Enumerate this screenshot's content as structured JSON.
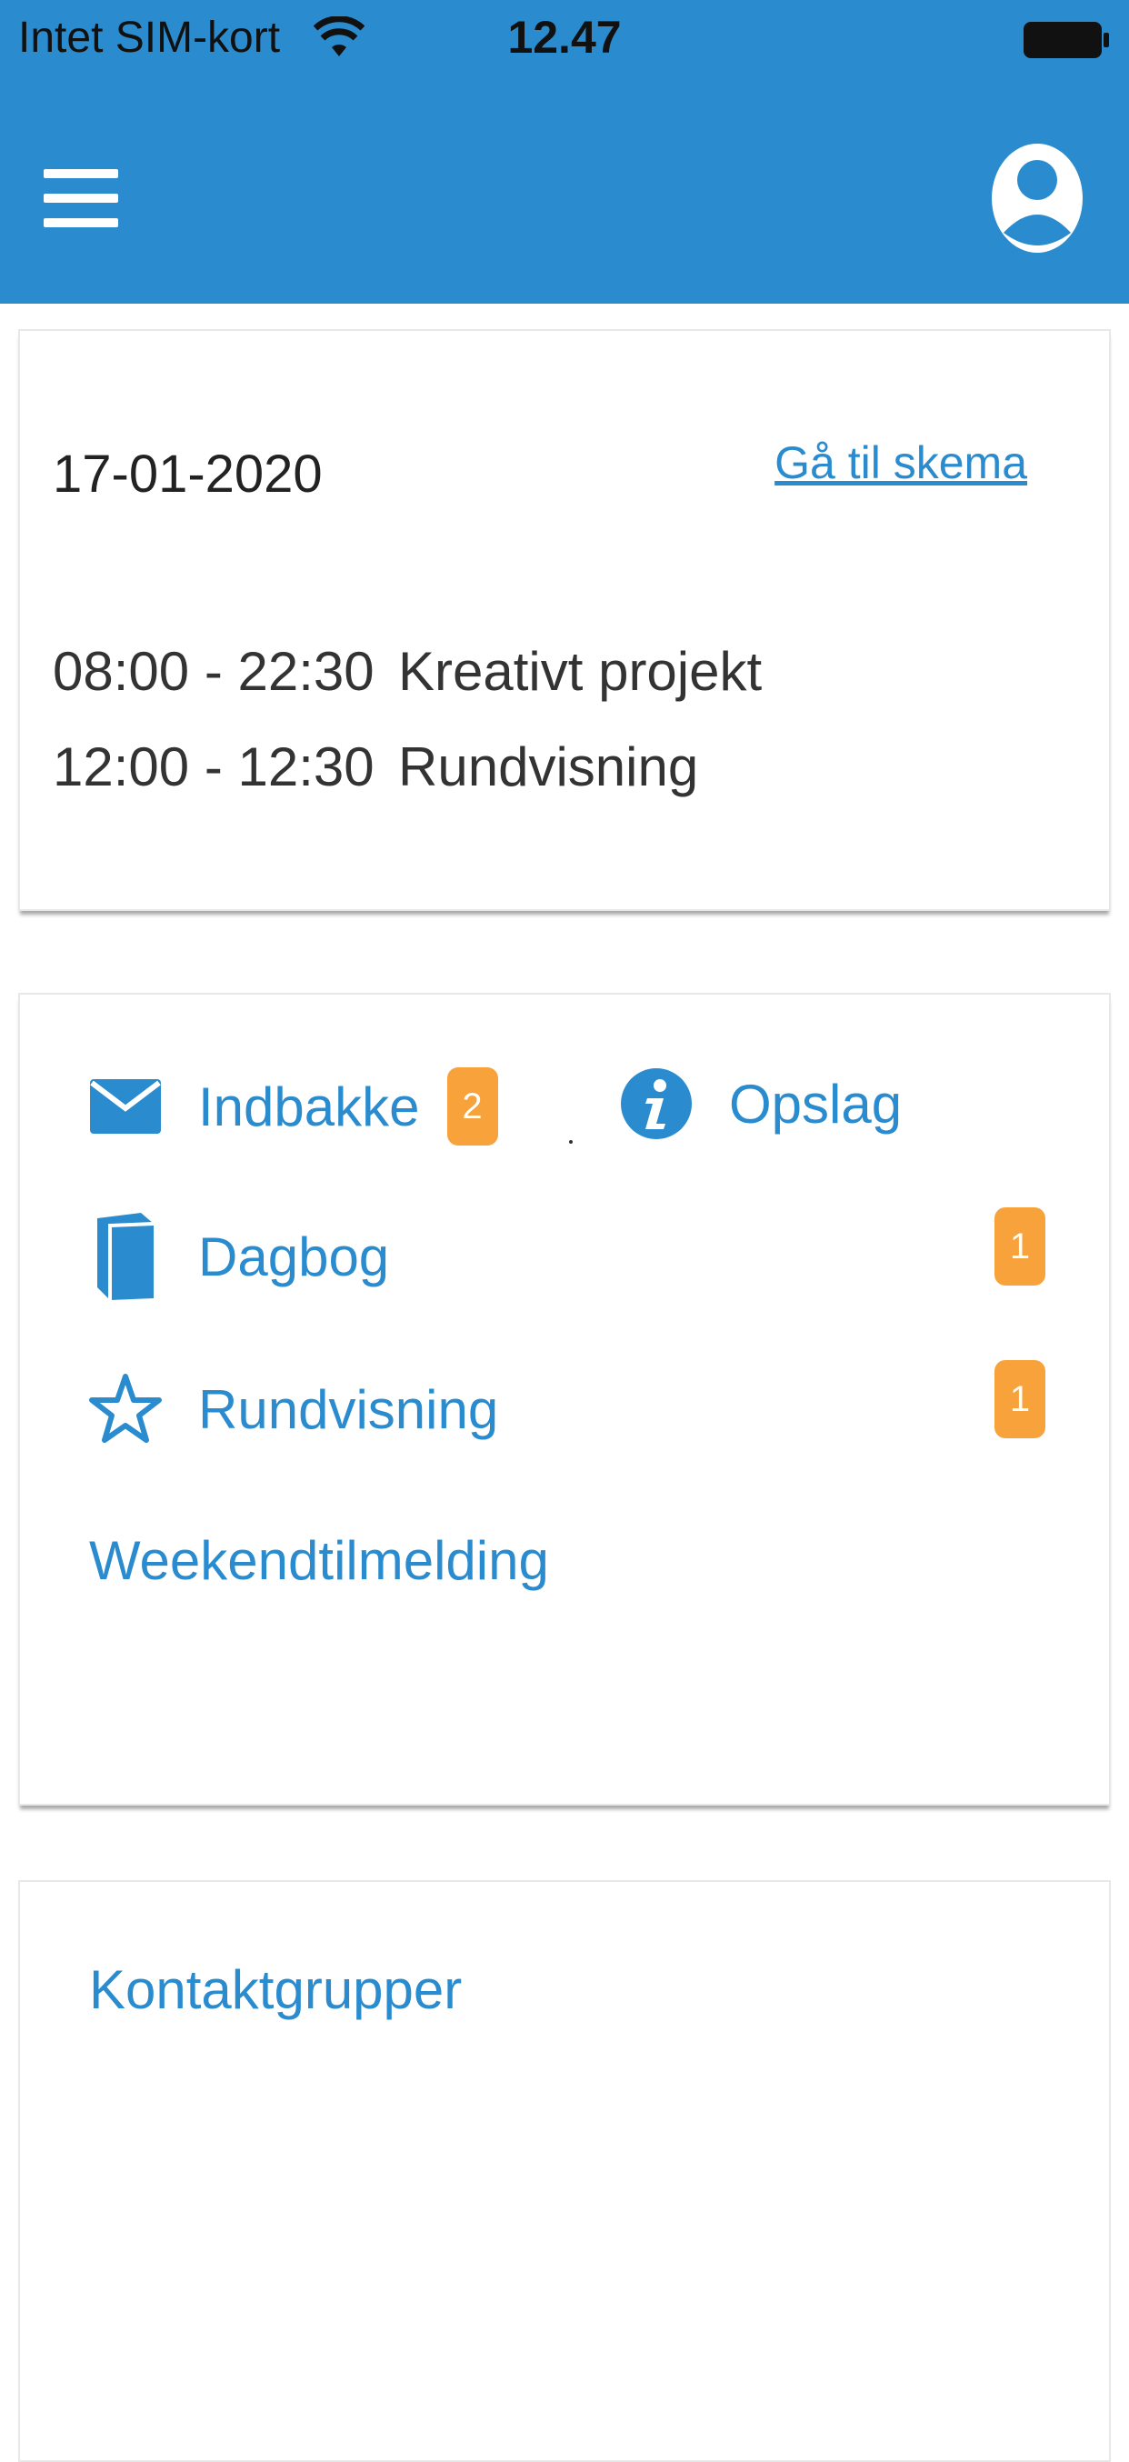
{
  "status_bar": {
    "carrier": "Intet SIM-kort",
    "time": "12.47"
  },
  "colors": {
    "primary": "#2a8ccf",
    "badge": "#f7a23a"
  },
  "header": {
    "menu_icon": "hamburger-menu-icon",
    "profile_icon": "user-avatar-icon"
  },
  "schedule": {
    "date": "17-01-2020",
    "link_label": "Gå til skema",
    "events": [
      {
        "time": "08:00 - 22:30",
        "title": "Kreativt projekt"
      },
      {
        "time": "12:00 - 12:30",
        "title": "Rundvisning"
      }
    ]
  },
  "menu": {
    "items": [
      {
        "label": "Indbakke",
        "icon": "envelope-icon",
        "badge": "2"
      },
      {
        "label": "Opslag",
        "icon": "info-icon"
      },
      {
        "label": "Dagbog",
        "icon": "book-icon",
        "badge": "1"
      },
      {
        "label": "Rundvisning",
        "icon": "star-icon",
        "badge": "1"
      },
      {
        "label": "Weekendtilmelding"
      }
    ]
  },
  "contacts": {
    "title": "Kontaktgrupper"
  }
}
